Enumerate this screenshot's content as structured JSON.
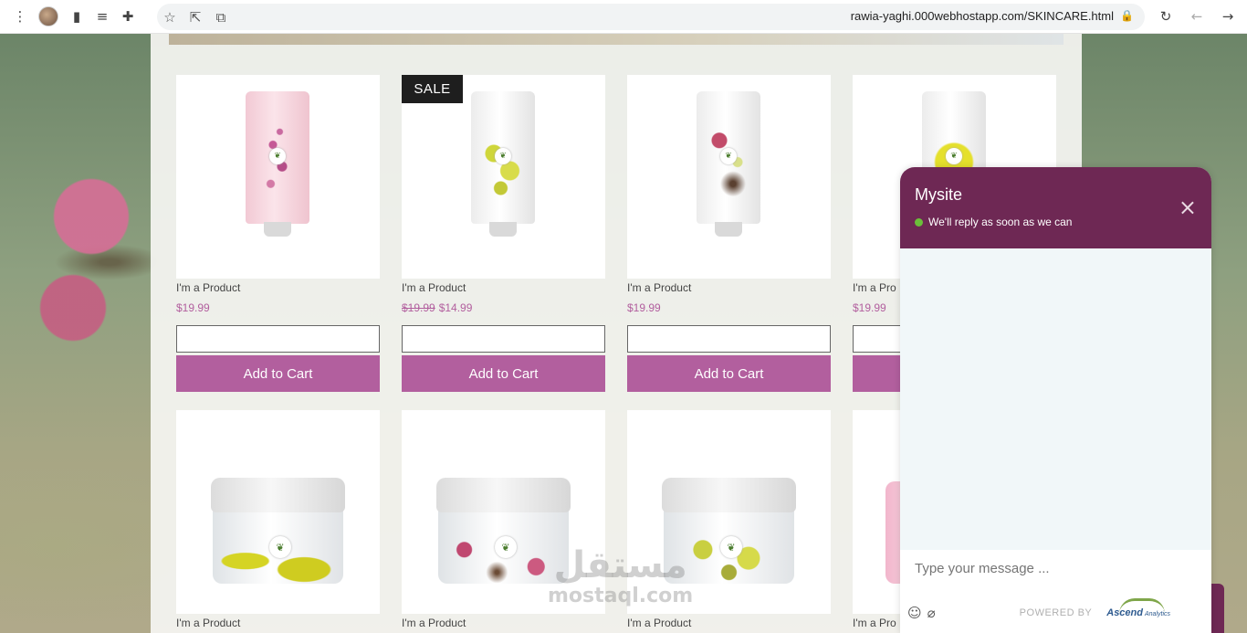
{
  "browser": {
    "url": "rawia-yaghi.000webhostapp.com/SKINCARE.html"
  },
  "products_row1": [
    {
      "name": "I'm a Product",
      "price": "$19.99",
      "old_price": "",
      "sale": false,
      "cart": "Add to Cart"
    },
    {
      "name": "I'm a Product",
      "price": "$14.99",
      "old_price": "$19.99",
      "sale": true,
      "sale_label": "SALE",
      "cart": "Add to Cart"
    },
    {
      "name": "I'm a Product",
      "price": "$19.99",
      "old_price": "",
      "sale": false,
      "cart": "Add to Cart"
    },
    {
      "name": "I'm a Pro",
      "price": "$19.99",
      "old_price": "",
      "sale": false,
      "cart": ""
    }
  ],
  "products_row2": [
    {
      "name": "I'm a Product"
    },
    {
      "name": "I'm a Product"
    },
    {
      "name": "I'm a Product"
    },
    {
      "name": "I'm a Pro"
    }
  ],
  "chat": {
    "title": "Mysite",
    "status": "We'll reply as soon as we can",
    "close": "×",
    "placeholder": "Type your message ...",
    "powered_by": "POWERED BY",
    "brand": "Ascend",
    "brand_sub": "Analytics"
  },
  "watermark": {
    "arabic": "مستقل",
    "latin": "mostaql.com"
  },
  "colors": {
    "accent": "#b25f9e",
    "chat_header": "#6e2854",
    "status_dot": "#6bbf3a"
  }
}
